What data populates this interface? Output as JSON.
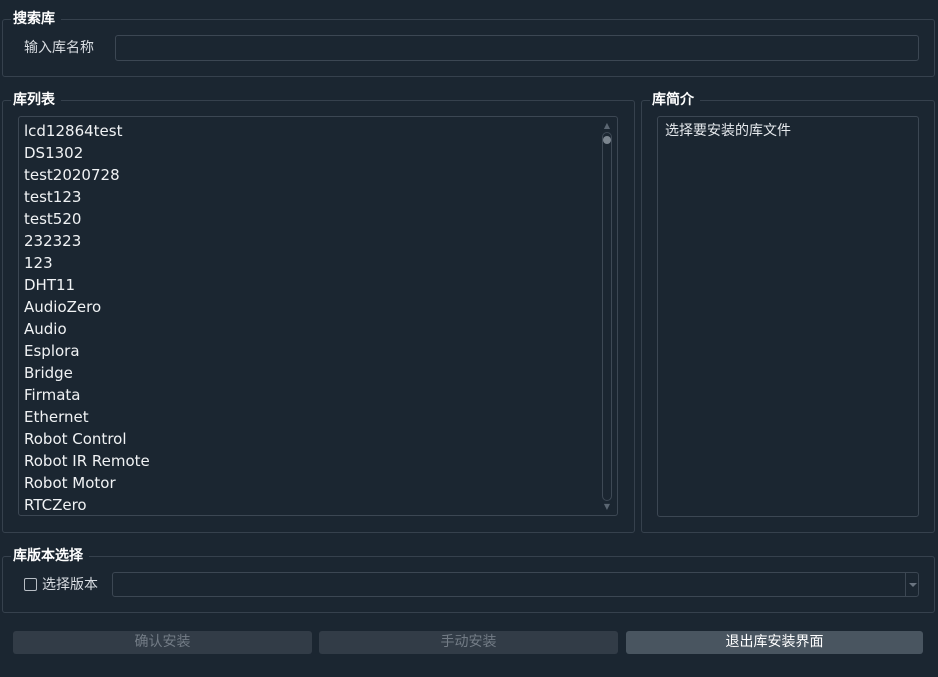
{
  "search": {
    "title": "搜索库",
    "label": "输入库名称",
    "value": "",
    "placeholder": ""
  },
  "library_list": {
    "title": "库列表",
    "items": [
      "lcd12864test",
      "DS1302",
      "test2020728",
      "test123",
      "test520",
      "232323",
      "123",
      "DHT11",
      "AudioZero",
      "Audio",
      "Esplora",
      "Bridge",
      "Firmata",
      "Ethernet",
      "Robot Control",
      "Robot IR Remote",
      "Robot Motor",
      "RTCZero"
    ]
  },
  "description": {
    "title": "库简介",
    "text": "选择要安装的库文件"
  },
  "version": {
    "title": "库版本选择",
    "checkbox_label": "选择版本",
    "checked": false,
    "selected": ""
  },
  "buttons": {
    "confirm": "确认安装",
    "manual": "手动安装",
    "exit": "退出库安装界面"
  }
}
